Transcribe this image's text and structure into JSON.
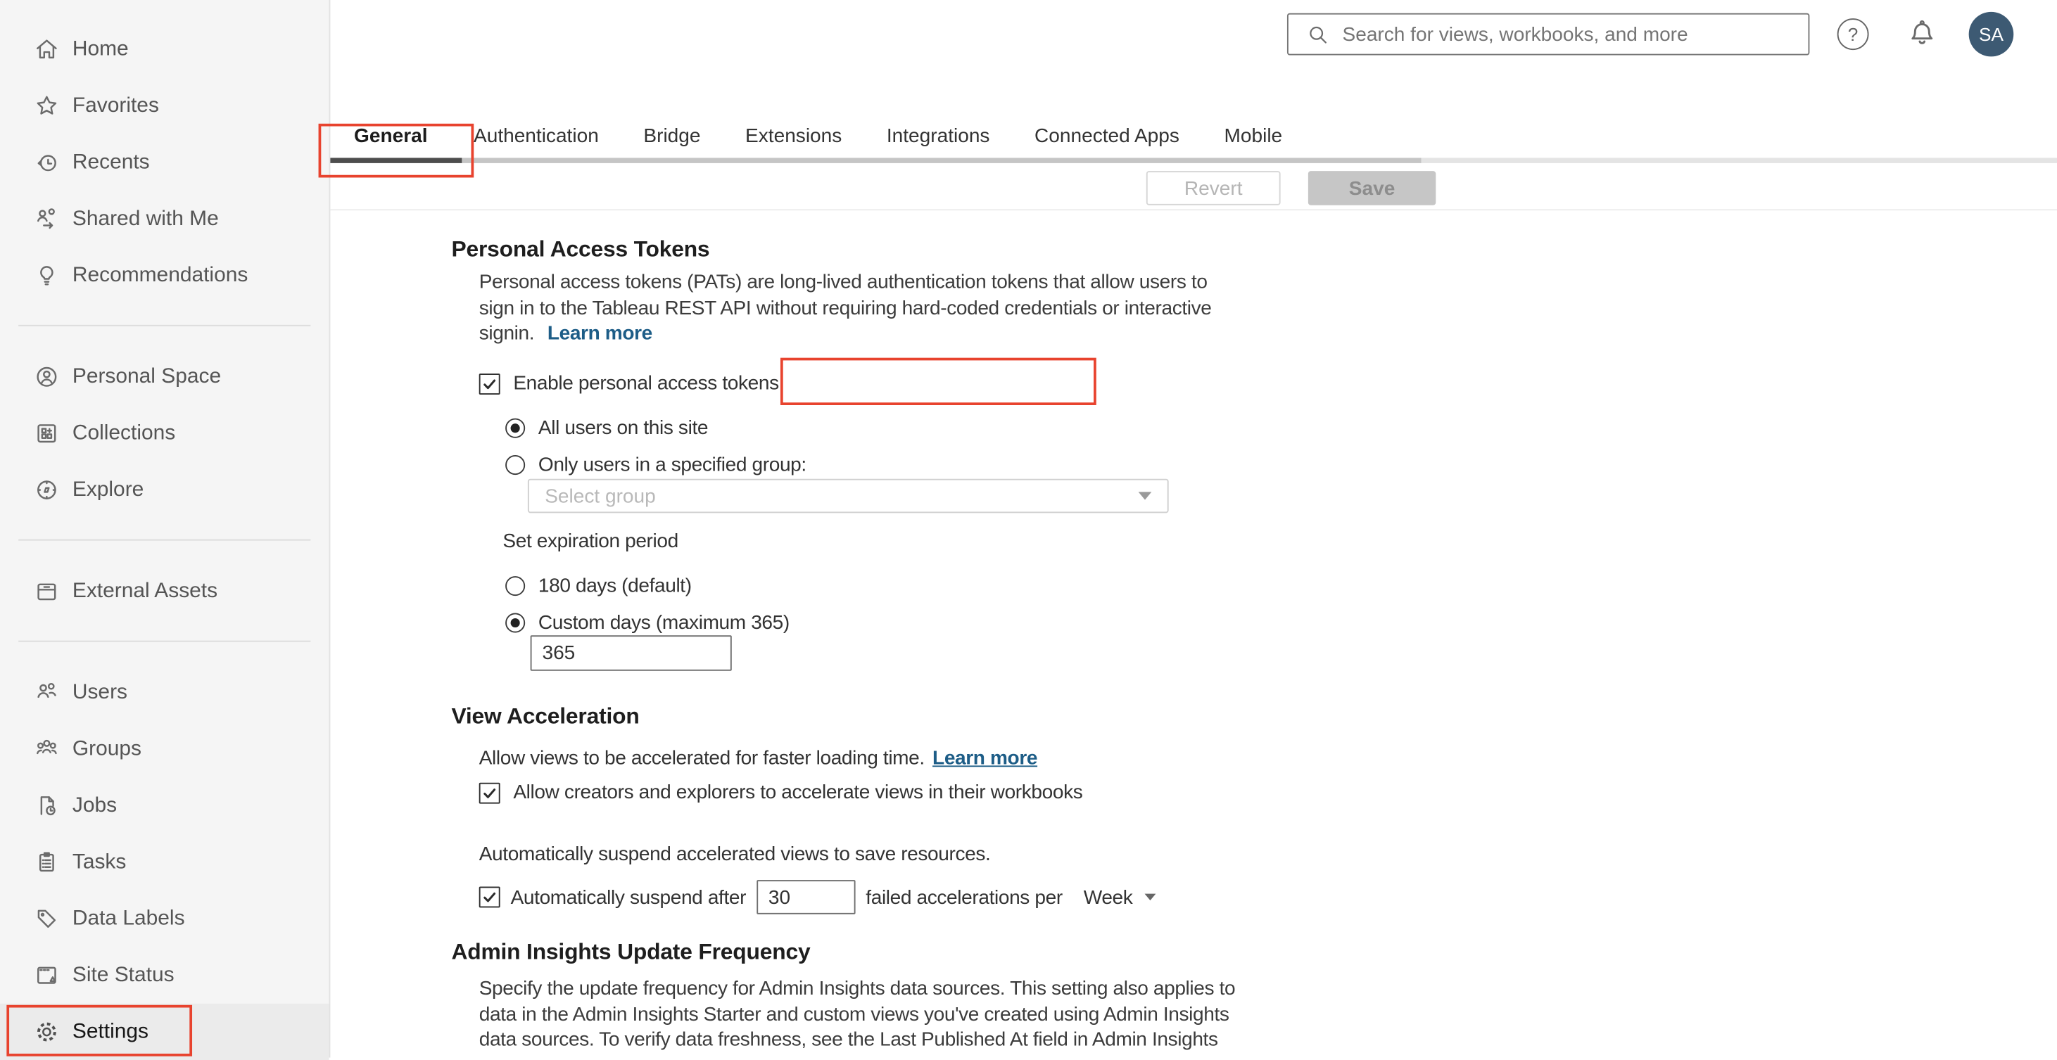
{
  "header": {
    "search_placeholder": "Search for views, workbooks, and more",
    "help_glyph": "?",
    "avatar_initials": "SA",
    "avatar_color": "#3d5a73"
  },
  "sidebar": {
    "groups": [
      {
        "items": [
          {
            "label": "Home",
            "icon": "home-icon"
          },
          {
            "label": "Favorites",
            "icon": "star-icon"
          },
          {
            "label": "Recents",
            "icon": "recents-icon"
          },
          {
            "label": "Shared with Me",
            "icon": "shared-with-me-icon"
          },
          {
            "label": "Recommendations",
            "icon": "lightbulb-icon"
          }
        ]
      },
      {
        "items": [
          {
            "label": "Personal Space",
            "icon": "person-circle-icon"
          },
          {
            "label": "Collections",
            "icon": "collections-icon"
          },
          {
            "label": "Explore",
            "icon": "compass-icon"
          }
        ]
      },
      {
        "items": [
          {
            "label": "External Assets",
            "icon": "archive-icon"
          }
        ]
      },
      {
        "items": [
          {
            "label": "Users",
            "icon": "users-icon"
          },
          {
            "label": "Groups",
            "icon": "groups-icon"
          },
          {
            "label": "Jobs",
            "icon": "jobs-icon"
          },
          {
            "label": "Tasks",
            "icon": "tasks-icon"
          },
          {
            "label": "Data Labels",
            "icon": "tag-icon"
          },
          {
            "label": "Site Status",
            "icon": "site-status-icon"
          },
          {
            "label": "Settings",
            "icon": "gear-icon",
            "selected": true
          }
        ]
      }
    ]
  },
  "tabs": {
    "items": [
      "General",
      "Authentication",
      "Bridge",
      "Extensions",
      "Integrations",
      "Connected Apps",
      "Mobile"
    ],
    "active": "General"
  },
  "toolbar": {
    "revert_label": "Revert",
    "save_label": "Save"
  },
  "sections": {
    "pat": {
      "title": "Personal Access Tokens",
      "description": "Personal access tokens (PATs) are long-lived authentication tokens that allow users to\nsign in to the Tableau REST API without requiring hard-coded credentials or interactive\nsignin.",
      "learn_more": "Learn more",
      "enable_label": "Enable personal access tokens",
      "enable_checked": true,
      "radio_all_users": "All users on this site",
      "radio_group": "Only users in a specified group:",
      "group_select_placeholder": "Select group",
      "expiration_label": "Set expiration period",
      "radio_default": "180 days (default)",
      "radio_custom": "Custom days (maximum 365)",
      "custom_days_value": "365"
    },
    "view_acceleration": {
      "title": "View Acceleration",
      "description": "Allow views to be accelerated for faster loading time.",
      "learn_more": "Learn more",
      "allow_label": "Allow creators and explorers to accelerate views in their workbooks",
      "allow_checked": true,
      "suspend_note": "Automatically suspend accelerated views to save resources.",
      "suspend_prefix": "Automatically suspend after",
      "suspend_value": "30",
      "suspend_suffix": "failed accelerations per",
      "period_value": "Week",
      "suspend_checked": true
    },
    "admin_insights": {
      "title": "Admin Insights Update Frequency",
      "description": "Specify the update frequency for Admin Insights data sources. This setting also applies to\ndata in the Admin Insights Starter and custom views you've created using Admin Insights\ndata sources. To verify data freshness, see the Last Published At field in Admin Insights"
    }
  },
  "annotations": {
    "color": "#e8432e"
  }
}
